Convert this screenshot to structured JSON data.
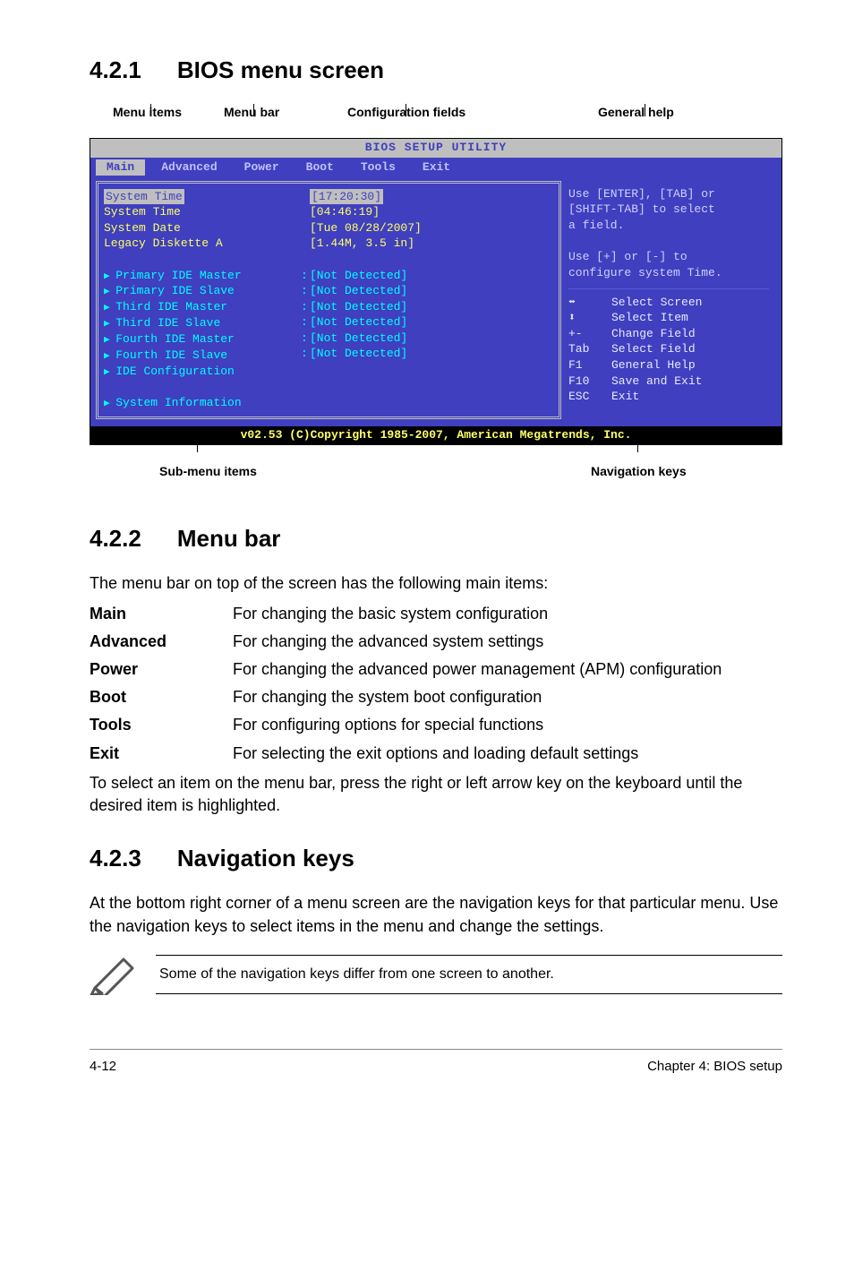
{
  "sec1": {
    "num": "4.2.1",
    "title": "BIOS menu screen"
  },
  "toplabels": {
    "menu_items": "Menu items",
    "menu_bar": "Menu bar",
    "config": "Configuration fields",
    "general": "General help"
  },
  "bios": {
    "title": "BIOS SETUP UTILITY",
    "tabs": [
      "Main",
      "Advanced",
      "Power",
      "Boot",
      "Tools",
      "Exit"
    ],
    "left_col1": [
      "System Time",
      "System Time",
      "System Date",
      "Legacy Diskette A",
      "",
      "Primary IDE Master",
      "Primary IDE Slave",
      "Third IDE Master",
      "Third IDE Slave",
      "Fourth IDE Master",
      "Fourth IDE Slave",
      "IDE Configuration",
      "",
      "System Information"
    ],
    "left_col2": [
      "[17:20:30]",
      "[04:46:19]",
      "[Tue 08/28/2007]",
      "[1.44M, 3.5 in]",
      "",
      "[Not Detected]",
      "[Not Detected]",
      "[Not Detected]",
      "[Not Detected]",
      "[Not Detected]",
      "[Not Detected]"
    ],
    "help_upper": [
      "Use [ENTER], [TAB] or",
      "[SHIFT-TAB] to select",
      "a field.",
      "",
      "Use [+] or [-] to",
      "configure system Time."
    ],
    "nav": [
      [
        "⬌",
        "Select Screen"
      ],
      [
        "⬍",
        "Select Item"
      ],
      [
        "+-",
        "Change Field"
      ],
      [
        "Tab",
        "Select Field"
      ],
      [
        "F1",
        "General Help"
      ],
      [
        "F10",
        "Save and Exit"
      ],
      [
        "ESC",
        "Exit"
      ]
    ],
    "footer": "v02.53 (C)Copyright 1985-2007, American Megatrends, Inc."
  },
  "bottomlabels": {
    "sub": "Sub-menu items",
    "nav": "Navigation keys"
  },
  "sec2": {
    "num": "4.2.2",
    "title": "Menu bar",
    "intro": "The menu bar on top of the screen has the following main items:",
    "rows": [
      [
        "Main",
        "For changing the basic system configuration"
      ],
      [
        "Advanced",
        "For changing the advanced system settings"
      ],
      [
        "Power",
        "For changing the advanced power management (APM) configuration"
      ],
      [
        "Boot",
        "For changing the system boot configuration"
      ],
      [
        "Tools",
        "For configuring options for special functions"
      ],
      [
        "Exit",
        "For selecting the exit options and loading default settings"
      ]
    ],
    "outro": "To select an item on the menu bar, press the right or left arrow key on the keyboard until the desired item is highlighted."
  },
  "sec3": {
    "num": "4.2.3",
    "title": "Navigation keys",
    "body": "At the bottom right corner of a menu screen are the navigation keys for that particular menu. Use the navigation keys to select items in the menu and change the settings.",
    "note": "Some of the navigation keys differ from one screen to another."
  },
  "footer": {
    "left": "4-12",
    "right": "Chapter 4: BIOS setup"
  }
}
